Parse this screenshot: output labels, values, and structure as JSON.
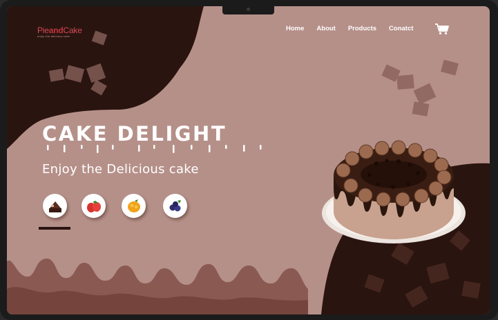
{
  "brand": {
    "name_part1": "Pie",
    "name_part2": "and",
    "name_part3": "Cake",
    "tagline": "enjoy the delicious cake"
  },
  "nav": {
    "items": [
      "Home",
      "About",
      "Products",
      "Conatct"
    ]
  },
  "hero": {
    "title": "CAKE DELIGHT",
    "subtitle": "Enjoy the Delicious cake"
  },
  "flavors": [
    {
      "name": "chocolate"
    },
    {
      "name": "strawberry"
    },
    {
      "name": "mango"
    },
    {
      "name": "blueberry"
    }
  ],
  "colors": {
    "background": "#b59089",
    "dark_chocolate": "#2a140f",
    "accent_pink": "#d14a57",
    "text_white": "#ffffff"
  },
  "icons": {
    "cart": "cart-icon"
  }
}
